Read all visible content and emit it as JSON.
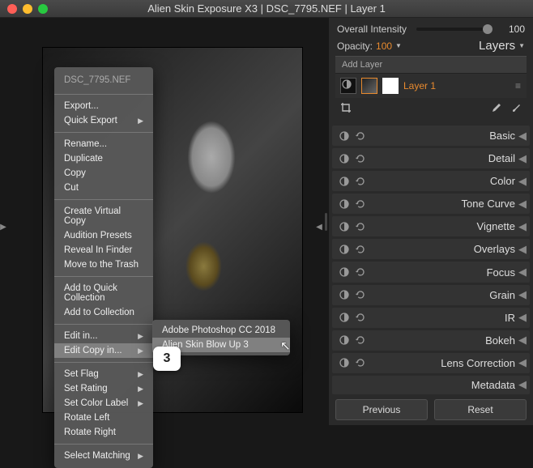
{
  "title": "Alien Skin Exposure X3 | DSC_7795.NEF | Layer 1",
  "ctx": {
    "header": "DSC_7795.NEF",
    "g1": [
      "Export...",
      "Quick Export"
    ],
    "g1_sub": [
      false,
      true
    ],
    "g2": [
      "Rename...",
      "Duplicate",
      "Copy",
      "Cut"
    ],
    "g3": [
      "Create Virtual Copy",
      "Audition Presets",
      "Reveal In Finder",
      "Move to the Trash"
    ],
    "g4": [
      "Add to Quick Collection",
      "Add to Collection"
    ],
    "g5": [
      "Edit in...",
      "Edit Copy in..."
    ],
    "g5_sub": [
      true,
      true
    ],
    "g5_hi": 1,
    "g6": [
      "Set Flag",
      "Set Rating",
      "Set Color Label",
      "Rotate Left",
      "Rotate Right"
    ],
    "g6_sub": [
      true,
      true,
      true,
      false,
      false
    ],
    "g7": [
      "Select Matching"
    ],
    "g7_sub": [
      true
    ]
  },
  "submenu": {
    "items": [
      "Adobe Photoshop CC 2018",
      "Alien Skin Blow Up 3"
    ],
    "hi": 1
  },
  "callout": "3",
  "right": {
    "overall_label": "Overall Intensity",
    "overall_val": "100",
    "opacity_label": "Opacity:",
    "opacity_val": "100",
    "layers_title": "Layers",
    "add_layer": "Add Layer",
    "layer1": "Layer 1",
    "panels": [
      "Basic",
      "Detail",
      "Color",
      "Tone Curve",
      "Vignette",
      "Overlays",
      "Focus",
      "Grain",
      "IR",
      "Bokeh",
      "Lens Correction"
    ],
    "metadata": "Metadata",
    "prev": "Previous",
    "reset": "Reset"
  }
}
